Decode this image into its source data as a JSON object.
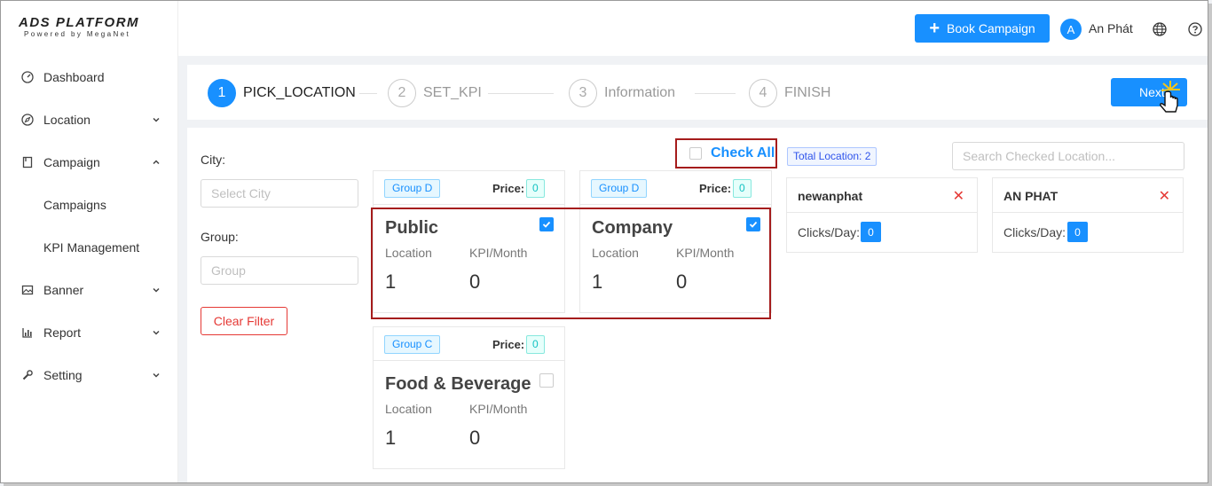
{
  "app": {
    "logo_title": "ADS PLATFORM",
    "logo_subtitle": "Powered by MegaNet"
  },
  "sidebar": {
    "items": [
      {
        "label": "Dashboard",
        "icon": "dashboard-icon"
      },
      {
        "label": "Location",
        "icon": "compass-icon"
      },
      {
        "label": "Campaign",
        "icon": "book-icon"
      },
      {
        "label": "Campaigns"
      },
      {
        "label": "KPI Management"
      },
      {
        "label": "Banner",
        "icon": "picture-icon"
      },
      {
        "label": "Report",
        "icon": "bar-chart-icon"
      },
      {
        "label": "Setting",
        "icon": "wrench-icon"
      }
    ]
  },
  "header": {
    "book_label": "Book Campaign",
    "avatar_letter": "A",
    "username": "An Phát"
  },
  "steps": [
    {
      "num": "1",
      "label": "PICK_LOCATION",
      "active": true
    },
    {
      "num": "2",
      "label": "SET_KPI"
    },
    {
      "num": "3",
      "label": "Information"
    },
    {
      "num": "4",
      "label": "FINISH"
    }
  ],
  "next_label": "Next",
  "filters": {
    "city_label": "City:",
    "city_placeholder": "Select City",
    "group_label": "Group:",
    "group_placeholder": "Group",
    "clear_label": "Clear Filter"
  },
  "check_all_label": "Check All",
  "cards": [
    {
      "group": "Group D",
      "price_label": "Price:",
      "price": "0",
      "title": "Public",
      "location_label": "Location",
      "kpi_label": "KPI/Month",
      "location": "1",
      "kpi": "0",
      "checked": true
    },
    {
      "group": "Group D",
      "price_label": "Price:",
      "price": "0",
      "title": "Company",
      "location_label": "Location",
      "kpi_label": "KPI/Month",
      "location": "1",
      "kpi": "0",
      "checked": true
    },
    {
      "group": "Group C",
      "price_label": "Price:",
      "price": "0",
      "title": "Food & Beverage",
      "location_label": "Location",
      "kpi_label": "KPI/Month",
      "location": "1",
      "kpi": "0",
      "checked": false
    }
  ],
  "selected": {
    "total_label": "Total Location: 2",
    "search_placeholder": "Search Checked Location...",
    "items": [
      {
        "name": "newanphat",
        "clicks_label": "Clicks/Day:",
        "clicks": "0"
      },
      {
        "name": "AN PHAT",
        "clicks_label": "Clicks/Day:",
        "clicks": "0"
      }
    ]
  },
  "colors": {
    "primary": "#1890ff",
    "danger": "#e53935",
    "highlight": "#a51c1c"
  }
}
